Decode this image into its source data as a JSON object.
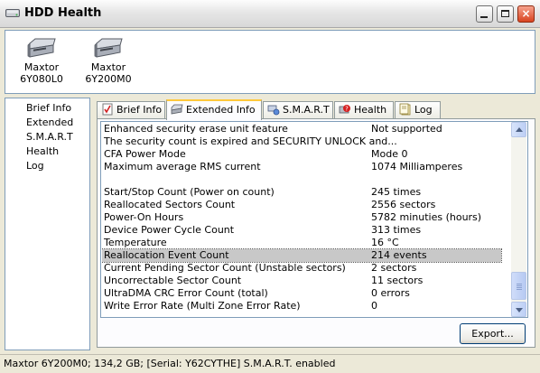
{
  "window": {
    "title": "HDD Health",
    "icon": "hdd-icon"
  },
  "window_buttons": {
    "minimize": "minimize-icon",
    "maximize": "maximize-icon",
    "close": "×"
  },
  "drives": [
    {
      "label_line1": "Maxtor",
      "label_line2": "6Y080L0",
      "icon": "hard-drive-icon"
    },
    {
      "label_line1": "Maxtor",
      "label_line2": "6Y200M0",
      "icon": "hard-drive-icon"
    }
  ],
  "nav": {
    "items": [
      "Brief Info",
      "Extended",
      "S.M.A.R.T",
      "Health",
      "Log"
    ]
  },
  "tabs": [
    {
      "label": "Brief Info",
      "icon": "checklist-icon"
    },
    {
      "label": "Extended Info",
      "icon": "hard-drive-icon"
    },
    {
      "label": "S.M.A.R.T",
      "icon": "network-drive-icon"
    },
    {
      "label": "Health",
      "icon": "health-warning-icon"
    },
    {
      "label": "Log",
      "icon": "log-document-icon"
    }
  ],
  "active_tab": "Extended Info",
  "rows": [
    {
      "key": "Enhanced security erase unit feature",
      "value": "Not supported"
    },
    {
      "key": "The security count is expired and SECURITY UNLOCK and...",
      "value": ""
    },
    {
      "key": "CFA Power Mode",
      "value": "Mode 0"
    },
    {
      "key": "Maximum average RMS current",
      "value": "1074 Milliamperes"
    },
    {
      "key": "",
      "value": ""
    },
    {
      "key": "Start/Stop Count (Power on count)",
      "value": "245 times"
    },
    {
      "key": "Reallocated Sectors Count",
      "value": "2556 sectors"
    },
    {
      "key": "Power-On Hours",
      "value": "5782 minuties (hours)"
    },
    {
      "key": "Device Power Cycle Count",
      "value": "313 times"
    },
    {
      "key": "Temperature",
      "value": "16 °C"
    },
    {
      "key": "Reallocation Event Count",
      "value": "214 events"
    },
    {
      "key": "Current Pending Sector Count (Unstable sectors)",
      "value": "2 sectors"
    },
    {
      "key": "Uncorrectable Sector Count",
      "value": "11 sectors"
    },
    {
      "key": "UltraDMA CRC Error Count (total)",
      "value": "0 errors"
    },
    {
      "key": "Write Error Rate (Multi Zone Error Rate)",
      "value": "0"
    }
  ],
  "selected_row": "Reallocation Event Count",
  "export_label": "Export...",
  "status_text": "Maxtor 6Y200M0;  134,2 GB;  [Serial: Y62CYTHE]   S.M.A.R.T. enabled"
}
